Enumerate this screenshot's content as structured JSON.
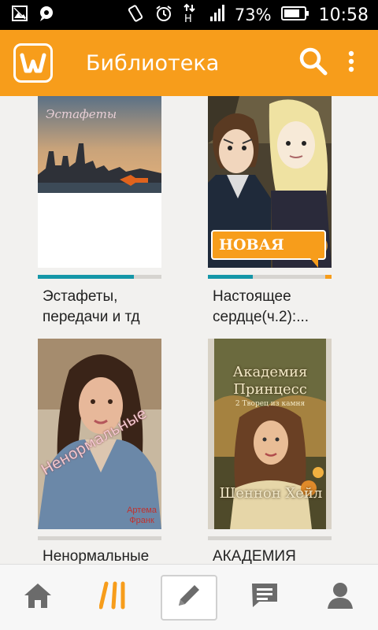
{
  "status_bar": {
    "battery_percent": "73%",
    "time": "10:58",
    "icons": [
      "gallery-icon",
      "chat-bubble-icon",
      "rotate-icon",
      "alarm-icon",
      "network-h-icon",
      "signal-icon",
      "battery-icon"
    ]
  },
  "app_bar": {
    "logo_icon": "wattpad-w-icon",
    "title": "Библиотека",
    "search_icon": "search-icon",
    "menu_icon": "overflow-menu-icon",
    "color": "#f79d1b"
  },
  "books": [
    {
      "title_line1": "Эстафеты,",
      "title_line2": "передачи и тд",
      "cover_text": "Эстафеты",
      "progress": 0.78,
      "is_new": false,
      "badge": ""
    },
    {
      "title_line1": "Настоящее",
      "title_line2": "сердце(ч.2):...",
      "cover_text": "",
      "progress": 0.36,
      "is_new": true,
      "badge": "НОВАЯ"
    },
    {
      "title_line1": "Ненормальные",
      "title_line2": "",
      "cover_text": "Ненормальные",
      "cover_author_line1": "Артема",
      "cover_author_line2": "Франк",
      "progress": 0,
      "is_new": false,
      "badge": ""
    },
    {
      "title_line1": "АКАДЕМИЯ",
      "title_line2": "",
      "cover_text": "Академия Принцесс",
      "cover_subtitle": "2 Творец из камня",
      "cover_author": "Шеннон Хейл",
      "progress": 0,
      "is_new": false,
      "badge": ""
    }
  ],
  "bottom_nav": {
    "items": [
      "home-icon",
      "library-icon",
      "write-icon",
      "messages-icon",
      "profile-icon"
    ],
    "active": "library-icon"
  },
  "colors": {
    "accent": "#f79d1b",
    "progress": "#1597a8"
  }
}
